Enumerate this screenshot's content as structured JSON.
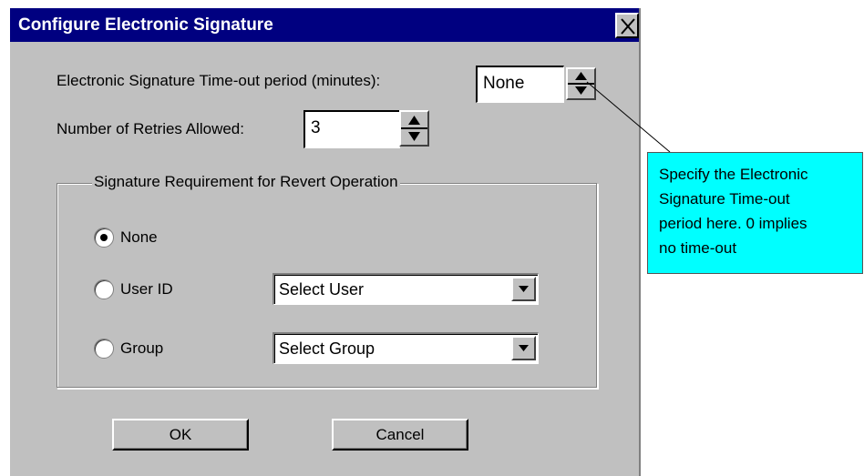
{
  "dialog": {
    "title": "Configure Electronic Signature",
    "close_glyph": "X"
  },
  "timeout": {
    "label": "Electronic Signature Time-out period (minutes):",
    "value": "None"
  },
  "retries": {
    "label": "Number of Retries Allowed:",
    "value": "3"
  },
  "revert_group": {
    "legend": "Signature Requirement for Revert Operation",
    "options": [
      {
        "label": "None",
        "selected": true
      },
      {
        "label": "User ID",
        "selected": false
      },
      {
        "label": "Group",
        "selected": false
      }
    ],
    "user_select": "Select User",
    "group_select": "Select Group"
  },
  "buttons": {
    "ok": "OK",
    "cancel": "Cancel"
  },
  "callout": {
    "lines": [
      "Specify the Electronic",
      "Signature Time-out",
      "period here. 0 implies",
      "no time-out"
    ]
  },
  "colors": {
    "titlebar": "#000080",
    "dialog_bg": "#c0c0c0",
    "callout_bg": "#00ffff"
  }
}
